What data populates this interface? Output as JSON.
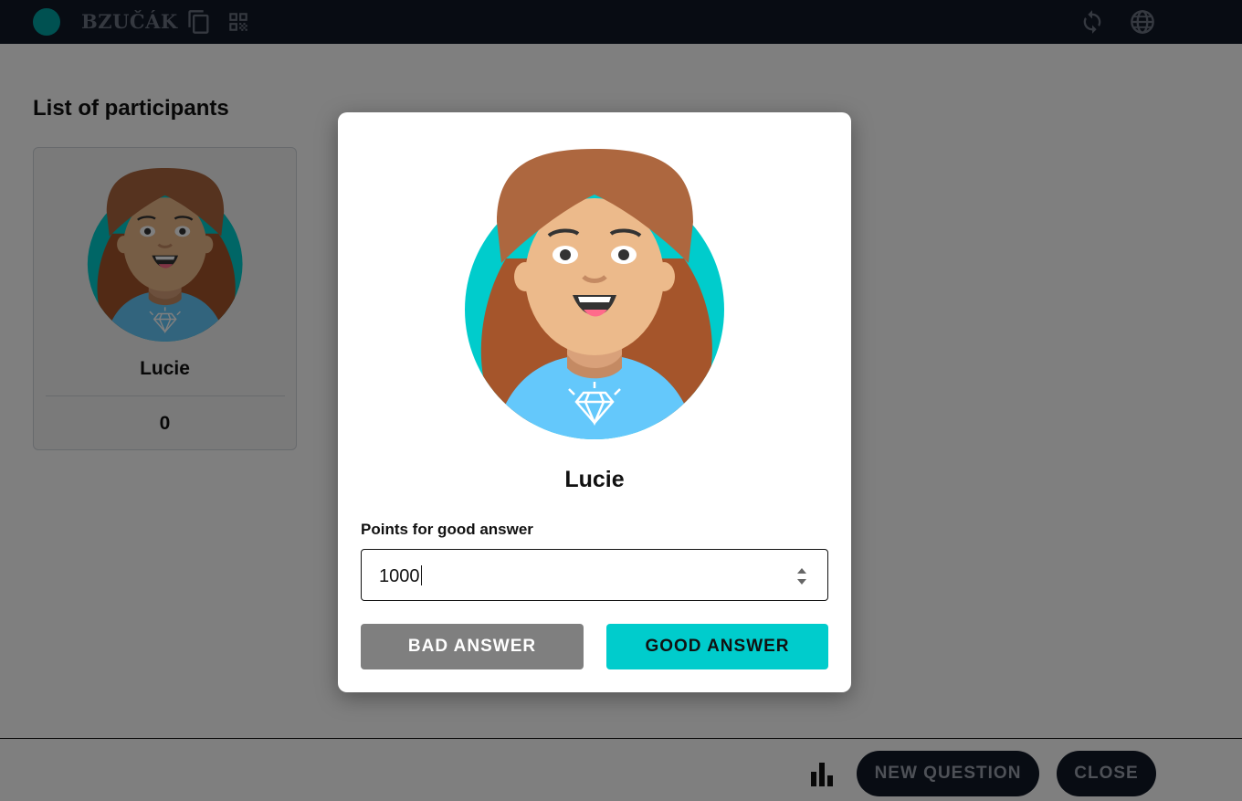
{
  "app": {
    "title": "BZUČÁK",
    "logo_color": "#00a3a3",
    "icons": [
      "copy-icon",
      "qr-code-icon",
      "refresh-icon",
      "globe-icon"
    ]
  },
  "page": {
    "list_title": "List of participants"
  },
  "participants": [
    {
      "name": "Lucie",
      "score": "0",
      "avatar": "girl-with-diamond-avatar"
    }
  ],
  "modal": {
    "participant_name": "Lucie",
    "points_label": "Points for good answer",
    "points_value": "1000",
    "bad_button": "BAD ANSWER",
    "good_button": "GOOD ANSWER"
  },
  "footer": {
    "stats_icon": "bar-chart-icon",
    "new_question_button": "NEW QUESTION",
    "close_button": "CLOSE"
  },
  "colors": {
    "topbar": "#111827",
    "accent": "#00cccc",
    "bad_button": "#7f7f7f",
    "dark_pill": "#111827"
  }
}
